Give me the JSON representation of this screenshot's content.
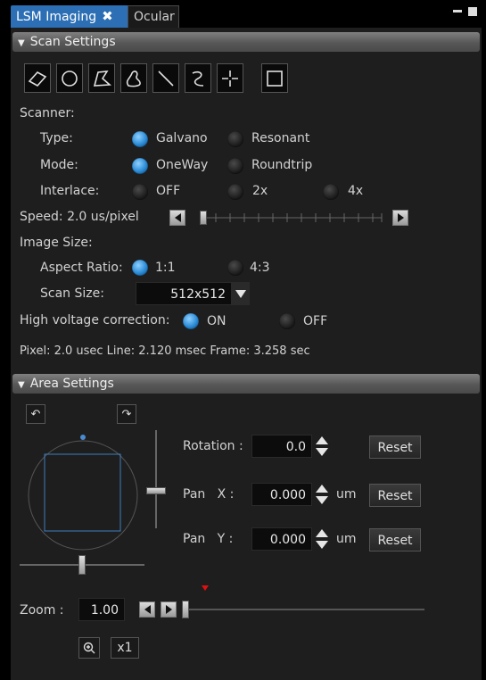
{
  "tabs": [
    {
      "label": "LSM Imaging",
      "close": "✖"
    },
    {
      "label": "Ocular"
    }
  ],
  "scan_settings": {
    "header": "Scan Settings",
    "tools": [
      "diamond-shape-icon",
      "circle-shape-icon",
      "polygon-shape-icon",
      "freehand-shape-icon",
      "line-icon",
      "curve-line-icon",
      "crosshair-icon",
      "rectangle-icon"
    ],
    "scanner_label": "Scanner:",
    "type_label": "Type:",
    "type_options": [
      "Galvano",
      "Resonant"
    ],
    "type_selected": "Galvano",
    "mode_label": "Mode:",
    "mode_options": [
      "OneWay",
      "Roundtrip"
    ],
    "mode_selected": "OneWay",
    "interlace_label": "Interlace:",
    "interlace_options": [
      "OFF",
      "2x",
      "4x"
    ],
    "interlace_selected": "OFF",
    "speed_label": "Speed:",
    "speed_value": "2.0 us/pixel",
    "speed_slider_fraction": 0.0,
    "image_size_label": "Image Size:",
    "aspect_label": "Aspect Ratio:",
    "aspect_options": [
      "1:1",
      "4:3"
    ],
    "aspect_selected": "1:1",
    "scan_size_label": "Scan Size:",
    "scan_size_value": "512x512",
    "hv_label": "High voltage correction:",
    "hv_options": [
      "ON",
      "OFF"
    ],
    "hv_selected": "ON",
    "timing_text": "Pixel: 2.0 usec Line: 2.120 msec Frame: 3.258 sec"
  },
  "area_settings": {
    "header": "Area Settings",
    "rotation_label": "Rotation :",
    "rotation_value": "0.0",
    "pan_x_label": "Pan   X :",
    "pan_x_value": "0.000",
    "pan_y_label": "Pan   Y :",
    "pan_y_value": "0.000",
    "unit": "um",
    "reset_label": "Reset",
    "zoom_label": "Zoom :",
    "zoom_value": "1.00",
    "zoom_slider_fraction": 0.0,
    "x1_label": "x1"
  },
  "colors": {
    "tab_active": "#2c6fb4",
    "radio_on": "#2a8bd6",
    "panel_bg": "#1e1e1e",
    "zoom_marker": "#e01010"
  }
}
